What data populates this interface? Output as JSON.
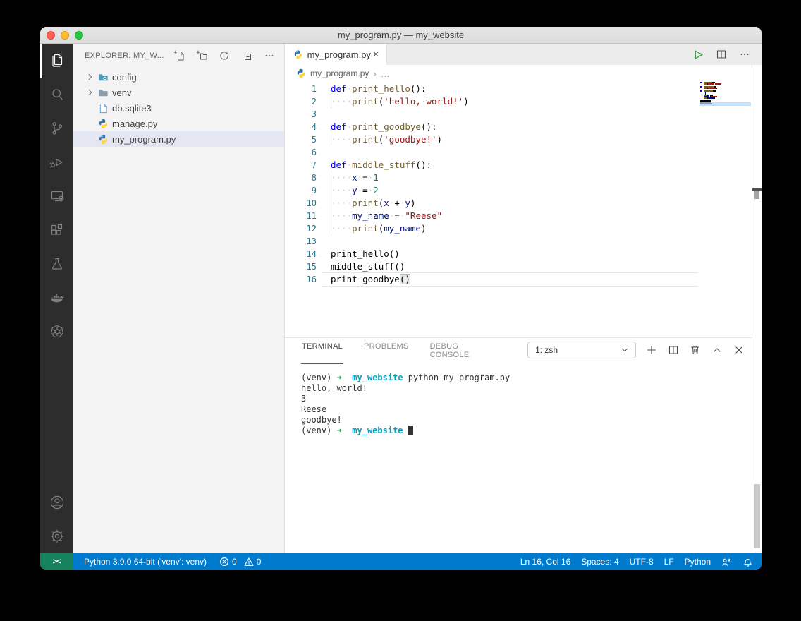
{
  "window": {
    "title": "my_program.py — my_website"
  },
  "sidebar": {
    "header": {
      "title": "EXPLORER: MY_W..."
    },
    "tree": [
      {
        "label": "config",
        "icon": "config-folder-icon",
        "expandable": true,
        "selected": false
      },
      {
        "label": "venv",
        "icon": "folder-icon",
        "expandable": true,
        "selected": false
      },
      {
        "label": "db.sqlite3",
        "icon": "database-file-icon",
        "expandable": false,
        "selected": false
      },
      {
        "label": "manage.py",
        "icon": "python-icon",
        "expandable": false,
        "selected": false
      },
      {
        "label": "my_program.py",
        "icon": "python-icon",
        "expandable": false,
        "selected": true
      }
    ]
  },
  "editor": {
    "tab": {
      "label": "my_program.py"
    },
    "breadcrumb": {
      "file": "my_program.py",
      "separator": "›",
      "more": "…"
    },
    "token_colors": {
      "kw": "#0000ff",
      "fn": "#795e26",
      "str": "#a31515",
      "num": "#098658",
      "var": "#001080",
      "pl": "#000000",
      "ws": "#d3d3d3",
      "bh": "#000000"
    },
    "current_line": 16,
    "lines": [
      {
        "n": 1,
        "guide": false,
        "tokens": [
          [
            "kw",
            "def"
          ],
          [
            "ws",
            " "
          ],
          [
            "fn",
            "print_hello"
          ],
          [
            "pl",
            "():"
          ]
        ]
      },
      {
        "n": 2,
        "guide": true,
        "tokens": [
          [
            "ws",
            "    "
          ],
          [
            "fn",
            "print"
          ],
          [
            "pl",
            "("
          ],
          [
            "str",
            "'hello,"
          ],
          [
            "ws",
            " "
          ],
          [
            "str",
            "world!'"
          ],
          [
            "pl",
            ")"
          ]
        ]
      },
      {
        "n": 3,
        "guide": false,
        "tokens": []
      },
      {
        "n": 4,
        "guide": false,
        "tokens": [
          [
            "kw",
            "def"
          ],
          [
            "ws",
            " "
          ],
          [
            "fn",
            "print_goodbye"
          ],
          [
            "pl",
            "():"
          ]
        ]
      },
      {
        "n": 5,
        "guide": true,
        "tokens": [
          [
            "ws",
            "    "
          ],
          [
            "fn",
            "print"
          ],
          [
            "pl",
            "("
          ],
          [
            "str",
            "'goodbye!'"
          ],
          [
            "pl",
            ")"
          ]
        ]
      },
      {
        "n": 6,
        "guide": false,
        "tokens": []
      },
      {
        "n": 7,
        "guide": false,
        "tokens": [
          [
            "kw",
            "def"
          ],
          [
            "ws",
            " "
          ],
          [
            "fn",
            "middle_stuff"
          ],
          [
            "pl",
            "():"
          ]
        ]
      },
      {
        "n": 8,
        "guide": true,
        "tokens": [
          [
            "ws",
            "    "
          ],
          [
            "var",
            "x"
          ],
          [
            "ws",
            " "
          ],
          [
            "pl",
            "="
          ],
          [
            "ws",
            " "
          ],
          [
            "num",
            "1"
          ]
        ]
      },
      {
        "n": 9,
        "guide": true,
        "tokens": [
          [
            "ws",
            "    "
          ],
          [
            "var",
            "y"
          ],
          [
            "ws",
            " "
          ],
          [
            "pl",
            "="
          ],
          [
            "ws",
            " "
          ],
          [
            "num",
            "2"
          ]
        ]
      },
      {
        "n": 10,
        "guide": true,
        "tokens": [
          [
            "ws",
            "    "
          ],
          [
            "fn",
            "print"
          ],
          [
            "pl",
            "("
          ],
          [
            "var",
            "x"
          ],
          [
            "ws",
            " "
          ],
          [
            "pl",
            "+"
          ],
          [
            "ws",
            " "
          ],
          [
            "var",
            "y"
          ],
          [
            "pl",
            ")"
          ]
        ]
      },
      {
        "n": 11,
        "guide": true,
        "tokens": [
          [
            "ws",
            "    "
          ],
          [
            "var",
            "my_name"
          ],
          [
            "ws",
            " "
          ],
          [
            "pl",
            "="
          ],
          [
            "ws",
            " "
          ],
          [
            "str",
            "\"Reese\""
          ]
        ]
      },
      {
        "n": 12,
        "guide": true,
        "tokens": [
          [
            "ws",
            "    "
          ],
          [
            "fn",
            "print"
          ],
          [
            "pl",
            "("
          ],
          [
            "var",
            "my_name"
          ],
          [
            "pl",
            ")"
          ]
        ]
      },
      {
        "n": 13,
        "guide": false,
        "tokens": []
      },
      {
        "n": 14,
        "guide": false,
        "tokens": [
          [
            "pl",
            "print_hello()"
          ]
        ]
      },
      {
        "n": 15,
        "guide": false,
        "tokens": [
          [
            "pl",
            "middle_stuff()"
          ]
        ]
      },
      {
        "n": 16,
        "guide": false,
        "tokens": [
          [
            "pl",
            "print_goodbye"
          ],
          [
            "bh",
            "()"
          ]
        ]
      }
    ]
  },
  "panel": {
    "tabs": [
      {
        "label": "TERMINAL",
        "active": true
      },
      {
        "label": "PROBLEMS",
        "active": false
      },
      {
        "label": "DEBUG CONSOLE",
        "active": false
      }
    ],
    "shell_select": "1: zsh",
    "terminal_lines": [
      [
        [
          "pl",
          "(venv) "
        ],
        [
          "arrow",
          "➜"
        ],
        [
          "pl",
          "  "
        ],
        [
          "dir",
          "my_website"
        ],
        [
          "pl",
          " python my_program.py"
        ]
      ],
      [
        [
          "pl",
          "hello, world!"
        ]
      ],
      [
        [
          "pl",
          "3"
        ]
      ],
      [
        [
          "pl",
          "Reese"
        ]
      ],
      [
        [
          "pl",
          "goodbye!"
        ]
      ],
      [
        [
          "pl",
          "(venv) "
        ],
        [
          "arrow",
          "➜"
        ],
        [
          "pl",
          "  "
        ],
        [
          "dir",
          "my_website"
        ],
        [
          "pl",
          " "
        ],
        [
          "cursor",
          " "
        ]
      ]
    ]
  },
  "status_bar": {
    "remote_glyph": "><",
    "interpreter": "Python 3.9.0 64-bit ('venv': venv)",
    "errors": "0",
    "warnings": "0",
    "right_items": [
      "Ln 16, Col 16",
      "Spaces: 4",
      "UTF-8",
      "LF",
      "Python"
    ]
  }
}
